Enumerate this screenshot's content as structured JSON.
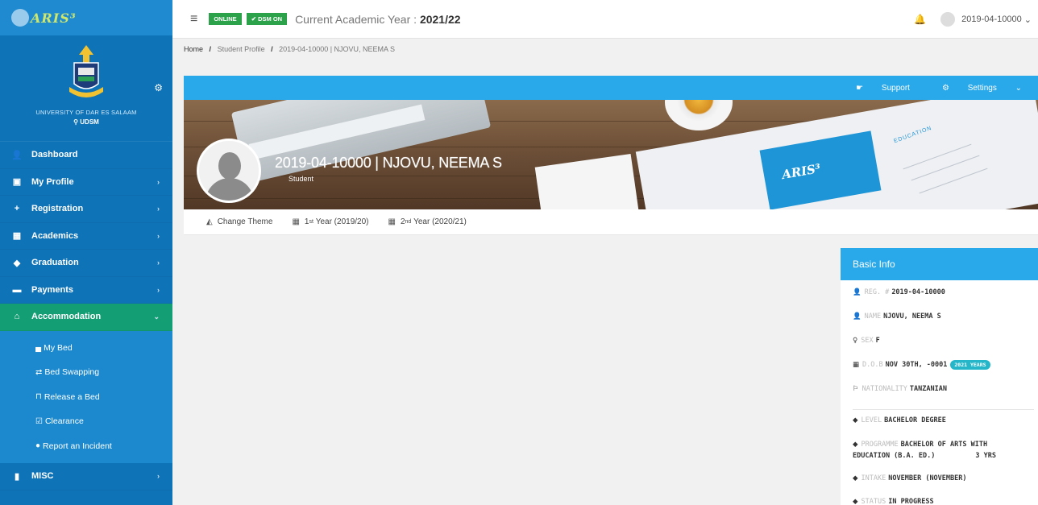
{
  "app": {
    "logo_text": "ARIS³"
  },
  "sidebar": {
    "university_name": "UNIVERSITY OF DAR ES SALAAM",
    "university_short": "UDSM",
    "items": [
      {
        "label": "Dashboard",
        "icon": "user-icon"
      },
      {
        "label": "My Profile",
        "icon": "profile-card-icon"
      },
      {
        "label": "Registration",
        "icon": "plus-icon"
      },
      {
        "label": "Academics",
        "icon": "book-icon"
      },
      {
        "label": "Graduation",
        "icon": "graduation-cap-icon"
      },
      {
        "label": "Payments",
        "icon": "money-icon"
      },
      {
        "label": "Accommodation",
        "icon": "home-icon"
      },
      {
        "label": "MISC",
        "icon": "bag-icon"
      }
    ],
    "accommodation_sub": [
      {
        "label": "My Bed",
        "icon": "bed-icon"
      },
      {
        "label": "Bed Swapping",
        "icon": "swap-icon"
      },
      {
        "label": "Release a Bed",
        "icon": "unlock-icon"
      },
      {
        "label": "Clearance",
        "icon": "clipboard-check-icon"
      },
      {
        "label": "Report an Incident",
        "icon": "comment-alert-icon"
      }
    ]
  },
  "topbar": {
    "online_label": "ONLINE",
    "dsm_label": "DSM ON",
    "academic_year_label": "Current Academic Year :",
    "academic_year_value": "2021/22",
    "username": "2019-04-10000"
  },
  "breadcrumb": {
    "home": "Home",
    "section": "Student Profile",
    "current": "2019-04-10000 | NJOVU, NEEMA S"
  },
  "cover": {
    "support_label": "Support",
    "settings_label": "Settings",
    "name": "2019-04-10000 | NJOVU, NEEMA S",
    "role": "Student",
    "tabs": [
      {
        "label": "Change Theme",
        "icon": "theme-icon"
      },
      {
        "ord": "1",
        "sup": "st",
        "label": "Year (2019/20)",
        "icon": "book-icon"
      },
      {
        "ord": "2",
        "sup": "nd",
        "label": "Year (2020/21)",
        "icon": "book-icon"
      }
    ]
  },
  "basic_info": {
    "title": "Basic Info",
    "rows": [
      {
        "key": "REG. #",
        "value": "2019-04-10000"
      },
      {
        "key": "NAME",
        "value": "NJOVU, NEEMA S"
      },
      {
        "key": "SEX",
        "value": "F"
      },
      {
        "key": "D.O.B",
        "value": "NOV 30TH, -0001",
        "badge": "2021 YEARS"
      },
      {
        "key": "NATIONALITY",
        "value": "TANZANIAN"
      },
      {
        "key": "LEVEL",
        "value": "BACHELOR DEGREE"
      },
      {
        "key": "PROGRAMME",
        "value": "BACHELOR OF ARTS WITH",
        "value2": "EDUCATION (B.A. ED.)",
        "value3": "3 YRS"
      },
      {
        "key": "INTAKE",
        "value": "NOVEMBER (NOVEMBER)"
      },
      {
        "key": "STATUS",
        "value": "IN PROGRESS"
      }
    ]
  },
  "colors": {
    "sidebar": "#0f73b8",
    "active": "#149e73",
    "accent": "#29a8ea",
    "online": "#2ca34b"
  }
}
